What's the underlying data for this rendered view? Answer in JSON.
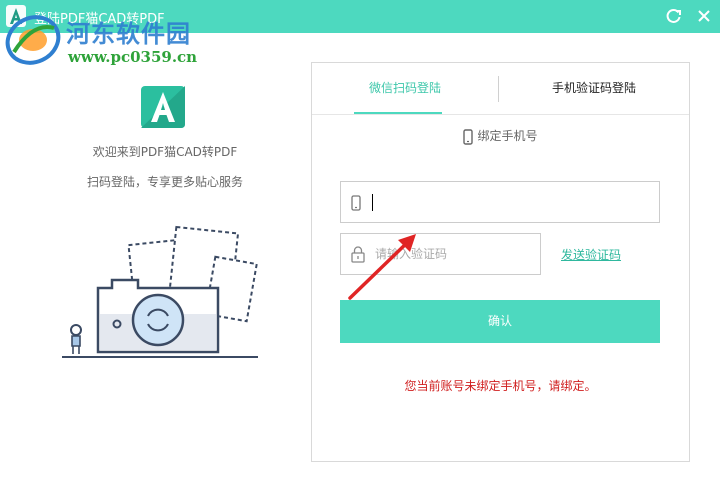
{
  "window": {
    "title": "登陆PDF猫CAD转PDF",
    "accent_color": "#4dd9bf",
    "icons": [
      "refresh-icon",
      "close-icon"
    ]
  },
  "watermark": {
    "site_name": "河东软件园",
    "url": "www.pc0359.cn"
  },
  "left": {
    "welcome": "欢迎来到PDF猫CAD转PDF",
    "subtitle": "扫码登陆，专享更多贴心服务"
  },
  "tabs": [
    {
      "label": "微信扫码登陆",
      "active": true
    },
    {
      "label": "手机验证码登陆",
      "active": false
    }
  ],
  "form": {
    "bind_label": "绑定手机号",
    "phone_value": "",
    "code_placeholder": "请输入验证码",
    "send_code": "发送验证码",
    "confirm": "确认",
    "error": "您当前账号未绑定手机号，请绑定。",
    "error_color": "#d02020"
  }
}
